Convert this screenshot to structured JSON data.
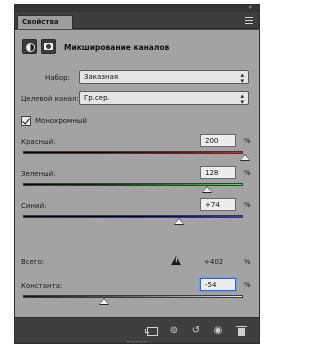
{
  "panel": {
    "tab_label": "Свойства",
    "header_title": "Микширование каналов",
    "preset_label": "Набор:",
    "preset_value": "Заказная",
    "output_label": "Целевой канал:",
    "output_value": "Гр.сер.",
    "monochrome_label": "Монохромный",
    "monochrome_checked": true
  },
  "channels": [
    {
      "label": "Красный:",
      "value": "200",
      "unit": "%",
      "slider_percent": 200
    },
    {
      "label": "Зеленый:",
      "value": "128",
      "unit": "%",
      "slider_percent": 128
    },
    {
      "label": "Синий:",
      "value": "+74",
      "unit": "%",
      "slider_percent": 74
    }
  ],
  "total": {
    "label": "Всего:",
    "value": "+402",
    "unit": "%",
    "warning_icon": "warning-triangle-icon"
  },
  "constant": {
    "label": "Константа:",
    "value": "-54",
    "unit": "%",
    "slider_percent": -54
  },
  "footer_icons": [
    "clip-to-layer-icon",
    "view-previous-icon",
    "reset-icon",
    "visibility-eye-icon",
    "trash-icon"
  ],
  "colors": {
    "panel_bg": "#a3a3a3",
    "chrome_dark": "#3f3f3f",
    "focus_blue": "#2f6ad4"
  }
}
